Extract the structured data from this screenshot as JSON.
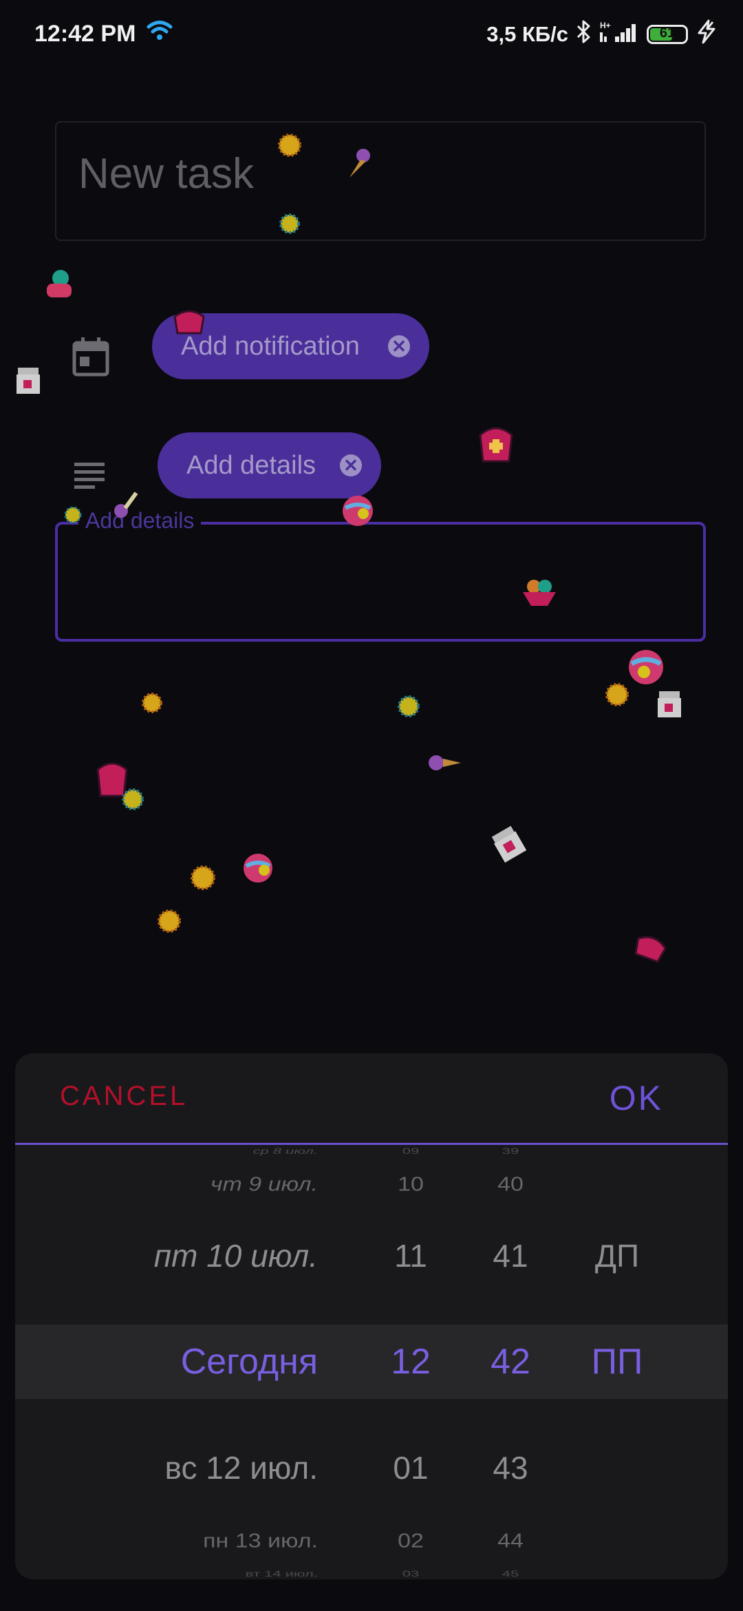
{
  "status_bar": {
    "time": "12:42 PM",
    "speed": "3,5 КБ/с",
    "battery": "61",
    "battery_level": 0.61
  },
  "task": {
    "title_placeholder": "New task"
  },
  "chips": {
    "notification_label": "Add notification",
    "details_label": "Add details",
    "close_glyph": "✕"
  },
  "details_field": {
    "label": "Add details",
    "value": ""
  },
  "icons": {
    "calendar": "calendar-icon",
    "notes": "notes-lines-icon",
    "wifi": "wifi-icon",
    "bluetooth": "bluetooth-icon",
    "signal": "signal-icon",
    "charging": "charging-bolt-icon"
  },
  "picker": {
    "cancel_label": "CANCEL",
    "ok_label": "OK",
    "dates": [
      "ср 8 июл.",
      "чт 9 июл.",
      "пт 10 июл.",
      "Сегодня",
      "вс 12 июл.",
      "пн 13 июл.",
      "вт 14 июл."
    ],
    "hours": [
      "09",
      "10",
      "11",
      "12",
      "01",
      "02",
      "03"
    ],
    "minutes": [
      "39",
      "40",
      "41",
      "42",
      "43",
      "44",
      "45"
    ],
    "ampm": [
      "",
      "",
      "ДП",
      "ПП",
      "",
      "",
      ""
    ],
    "selected_index": 3
  },
  "colors": {
    "accent": "#7a5fe0",
    "chip": "#4a2f9b",
    "cancel": "#b3102a",
    "background": "#0b0a0e"
  }
}
